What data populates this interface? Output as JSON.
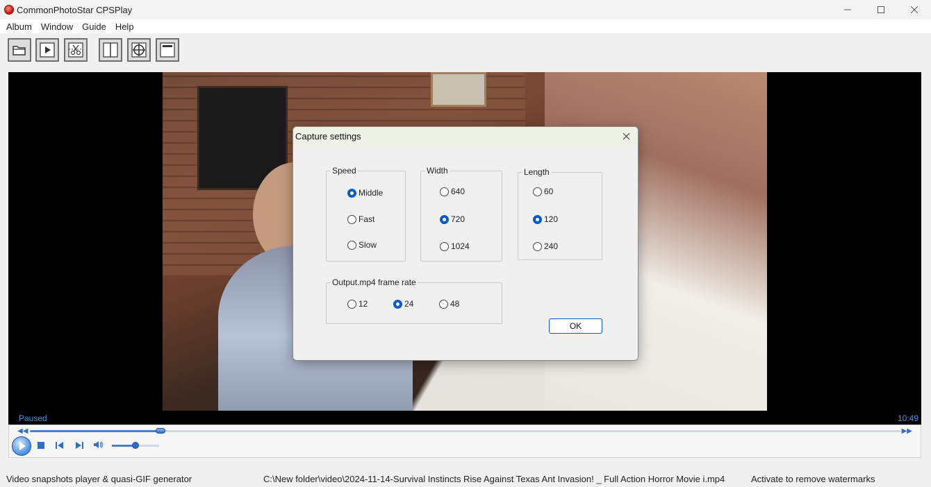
{
  "window": {
    "title": "CommonPhotoStar CPSPlay",
    "controls": [
      "minimize-icon",
      "maximize-icon",
      "close-icon"
    ]
  },
  "menu": {
    "items": [
      "Album",
      "Window",
      "Guide",
      "Help"
    ]
  },
  "toolbar": {
    "buttons": [
      "open-folder-icon",
      "play-icon",
      "cut-icon",
      "split-view-icon",
      "target-icon",
      "fullscreen-icon"
    ]
  },
  "player": {
    "status": "Paused",
    "time": "10:49",
    "seek_progress": 0.15,
    "volume_level": 0.5
  },
  "dialog": {
    "title": "Capture settings",
    "speed": {
      "label": "Speed",
      "options": [
        "Middle",
        "Fast",
        "Slow"
      ],
      "selected": "Middle"
    },
    "width": {
      "label": "Width",
      "options": [
        "640",
        "720",
        "1024"
      ],
      "selected": "720"
    },
    "length": {
      "label": "Length",
      "options": [
        "60",
        "120",
        "240"
      ],
      "selected": "120"
    },
    "framerate": {
      "label": "Output.mp4 frame rate",
      "options": [
        "12",
        "24",
        "48"
      ],
      "selected": "24"
    },
    "ok_label": "OK"
  },
  "statusbar": {
    "left": "Video snapshots player & quasi-GIF generator",
    "path": "C:\\New folder\\video\\2024-11-14-Survival Instincts Rise Against Texas Ant Invasion! _ Full Action Horror Movie i.mp4",
    "right": "Activate to remove watermarks"
  }
}
